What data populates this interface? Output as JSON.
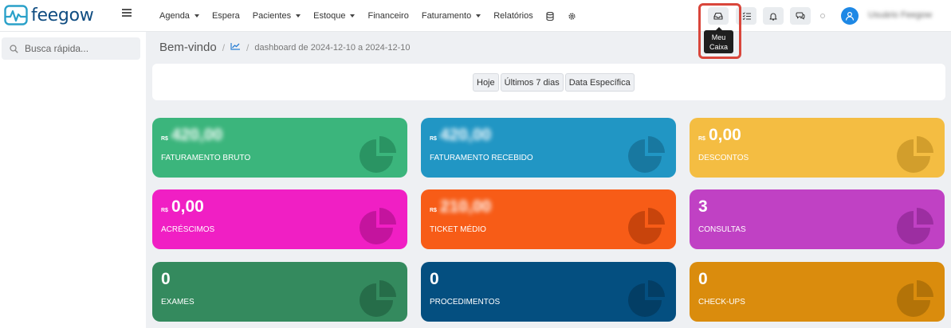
{
  "brand": {
    "name": "feegow"
  },
  "nav": {
    "items": [
      {
        "label": "Agenda",
        "caret": true
      },
      {
        "label": "Espera",
        "caret": false
      },
      {
        "label": "Pacientes",
        "caret": true
      },
      {
        "label": "Estoque",
        "caret": true
      },
      {
        "label": "Financeiro",
        "caret": false
      },
      {
        "label": "Faturamento",
        "caret": true
      },
      {
        "label": "Relatórios",
        "caret": false
      }
    ]
  },
  "toolbar": {
    "tooltip_line1": "Meu",
    "tooltip_line2": "Caixa",
    "user_name": "Usuário Feegow"
  },
  "sidebar": {
    "search_placeholder": "Busca rápida..."
  },
  "breadcrumb": {
    "title": "Bem-vindo",
    "current": "dashboard de 2024-12-10 a 2024-12-10"
  },
  "filters": {
    "today": "Hoje",
    "last7": "Últimos 7 dias",
    "specific": "Data Específica"
  },
  "cards": [
    {
      "currency": "R$",
      "value": "420,00",
      "label": "Faturamento Bruto",
      "blurred": true,
      "color": "#3bb57c",
      "icon_color": "#2a9463"
    },
    {
      "currency": "R$",
      "value": "420,00",
      "label": "Faturamento Recebido",
      "blurred": true,
      "color": "#2196c4",
      "icon_color": "#1878a0"
    },
    {
      "currency": "R$",
      "value": "0,00",
      "label": "Descontos",
      "blurred": false,
      "color": "#f4bd42",
      "icon_color": "#d29e2c"
    },
    {
      "currency": "R$",
      "value": "0,00",
      "label": "Acréscimos",
      "blurred": false,
      "color": "#f01fc4",
      "icon_color": "#c4149e"
    },
    {
      "currency": "R$",
      "value": "210,00",
      "label": "Ticket Médio",
      "blurred": true,
      "color": "#f75c17",
      "icon_color": "#c8440c"
    },
    {
      "currency": "",
      "value": "3",
      "label": "Consultas",
      "blurred": false,
      "color": "#c041c4",
      "icon_color": "#9c2ea1"
    },
    {
      "currency": "",
      "value": "0",
      "label": "Exames",
      "blurred": false,
      "color": "#348a5e",
      "icon_color": "#266d49"
    },
    {
      "currency": "",
      "value": "0",
      "label": "Procedimentos",
      "blurred": false,
      "color": "#044f80",
      "icon_color": "#033e65"
    },
    {
      "currency": "",
      "value": "0",
      "label": "Check-ups",
      "blurred": false,
      "color": "#da8c0d",
      "icon_color": "#b37308"
    }
  ]
}
